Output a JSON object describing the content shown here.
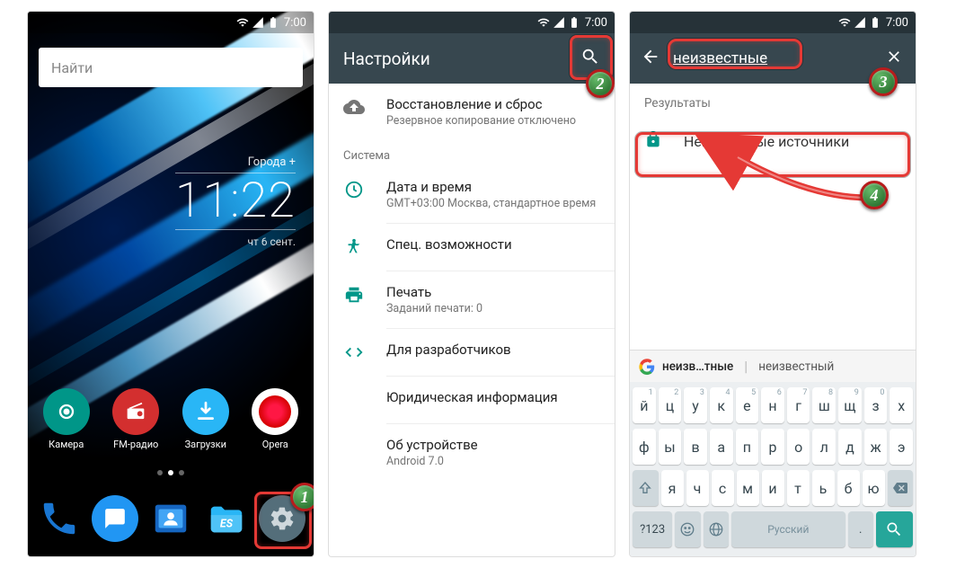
{
  "statusbar": {
    "time": "7:00"
  },
  "home": {
    "search_placeholder": "Найти",
    "widget": {
      "city": "Города +",
      "time": "11:22",
      "date": "чт 6 сент."
    },
    "apps_row1": [
      {
        "id": "camera",
        "label": "Камера"
      },
      {
        "id": "radio",
        "label": "FM-радио"
      },
      {
        "id": "downloads",
        "label": "Загрузки"
      },
      {
        "id": "opera",
        "label": "Opera"
      }
    ],
    "dock": [
      {
        "id": "phone"
      },
      {
        "id": "messages"
      },
      {
        "id": "contacts"
      },
      {
        "id": "es"
      },
      {
        "id": "settings"
      }
    ]
  },
  "settings": {
    "title": "Настройки",
    "backup": {
      "title": "Восстановление и сброс",
      "sub": "Резервное копирование отключено"
    },
    "section_system": "Система",
    "datetime": {
      "title": "Дата и время",
      "sub": "GMT+03:00 Москва, стандартное время"
    },
    "a11y": {
      "title": "Спец. возможности"
    },
    "print": {
      "title": "Печать",
      "sub": "Заданий печати: 0"
    },
    "dev": {
      "title": "Для разработчиков"
    },
    "legal": {
      "title": "Юридическая информация"
    },
    "about": {
      "title": "Об устройстве",
      "sub": "Android 7.0"
    }
  },
  "search": {
    "query": "неизвестные",
    "results_label": "Результаты",
    "result1": "Неизвестные источники",
    "suggest1": "неизв…тные",
    "suggest2": "неизвестный"
  },
  "keyboard": {
    "row1_chars": [
      "й",
      "ц",
      "у",
      "к",
      "е",
      "н",
      "г",
      "ш",
      "щ",
      "з",
      "х"
    ],
    "row1_sup": [
      "1",
      "2",
      "3",
      "4",
      "5",
      "6",
      "7",
      "8",
      "9",
      "0",
      ""
    ],
    "row2_chars": [
      "ф",
      "ы",
      "в",
      "а",
      "п",
      "р",
      "о",
      "л",
      "д",
      "ж",
      "э"
    ],
    "row3_chars": [
      "я",
      "ч",
      "с",
      "м",
      "и",
      "т",
      "ь",
      "б",
      "ю"
    ],
    "symkey": "?123",
    "space_label": "Русский"
  },
  "callouts": {
    "n1": "1",
    "n2": "2",
    "n3": "3",
    "n4": "4"
  }
}
